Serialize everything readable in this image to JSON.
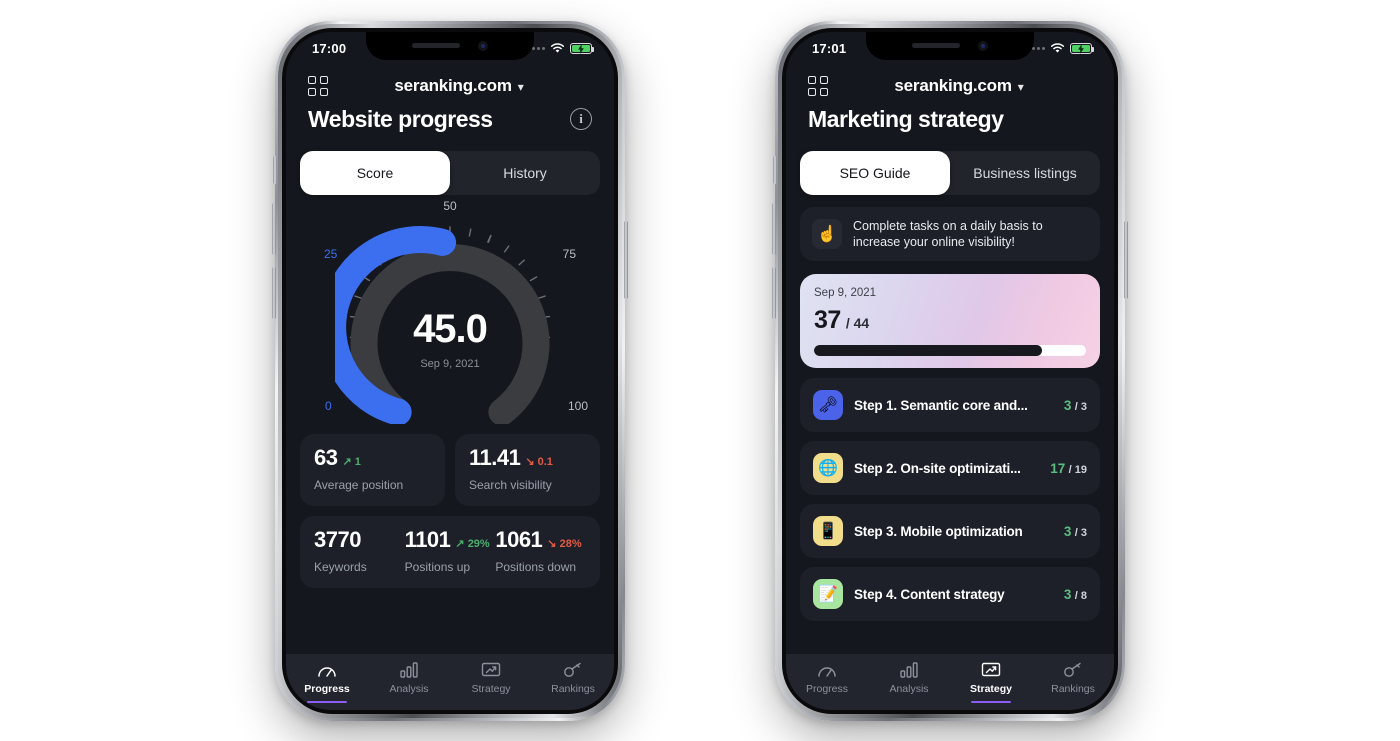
{
  "theme": {
    "bg": "#ffffff",
    "screen_bg": "#15171f",
    "card_bg": "#1d2029",
    "accent_blue": "#3b6ff0",
    "accent_purple": "#8b5cf6",
    "up": "#4caf6d",
    "down": "#e45b44"
  },
  "left": {
    "status": {
      "time": "17:00",
      "signal_icon": "signal-dots-icon",
      "wifi_icon": "wifi-icon",
      "battery_icon": "battery-charging-icon"
    },
    "header": {
      "menu_icon": "grid-menu-icon",
      "domain": "seranking.com",
      "chevron": "⌄",
      "info_icon": "info-icon"
    },
    "page_title": "Website progress",
    "tabs": [
      {
        "label": "Score",
        "active": true
      },
      {
        "label": "History",
        "active": false
      }
    ],
    "gauge": {
      "value": "45.0",
      "date": "Sep 9, 2021",
      "min": 0,
      "max": 100,
      "labels": {
        "zero": "0",
        "quarter": "25",
        "half": "50",
        "three_quarter": "75",
        "full": "100"
      }
    },
    "stats_primary": [
      {
        "value": "63",
        "delta": "1",
        "direction": "up",
        "arrow": "↗",
        "label": "Average position"
      },
      {
        "value": "11.41",
        "delta": "0.1",
        "direction": "down",
        "arrow": "↘",
        "label": "Search visibility"
      }
    ],
    "stats_secondary": [
      {
        "value": "3770",
        "delta": "",
        "direction": "",
        "arrow": "",
        "label": "Keywords"
      },
      {
        "value": "1101",
        "delta": "29%",
        "direction": "up",
        "arrow": "↗",
        "label": "Positions up"
      },
      {
        "value": "1061",
        "delta": "28%",
        "direction": "down",
        "arrow": "↘",
        "label": "Positions down"
      }
    ],
    "nav": [
      {
        "label": "Progress",
        "icon": "gauge-icon",
        "active": true
      },
      {
        "label": "Analysis",
        "icon": "bar-chart-icon",
        "active": false
      },
      {
        "label": "Strategy",
        "icon": "trending-up-screen-icon",
        "active": false
      },
      {
        "label": "Rankings",
        "icon": "key-icon",
        "active": false
      }
    ]
  },
  "right": {
    "status": {
      "time": "17:01",
      "signal_icon": "signal-dots-icon",
      "wifi_icon": "wifi-icon",
      "battery_icon": "battery-charging-icon"
    },
    "header": {
      "menu_icon": "grid-menu-icon",
      "domain": "seranking.com",
      "chevron": "⌄"
    },
    "page_title": "Marketing strategy",
    "tabs": [
      {
        "label": "SEO Guide",
        "active": true
      },
      {
        "label": "Business listings",
        "active": false
      }
    ],
    "banner": {
      "emoji": "☝",
      "emoji_name": "pointing-up-finger-icon",
      "text": "Complete tasks on a daily basis to increase your online visibility!"
    },
    "progress_card": {
      "date": "Sep 9, 2021",
      "completed": "37",
      "total": "/ 44",
      "percent": 84
    },
    "steps": [
      {
        "title": "Step 1. Semantic core and...",
        "done": "3",
        "total": "/ 3",
        "emoji": "🗝",
        "emoji_name": "key-icon",
        "bg": "#4b63e8"
      },
      {
        "title": "Step 2. On-site optimizati...",
        "done": "17",
        "total": "/ 19",
        "emoji": "🌐",
        "emoji_name": "globe-money-icon",
        "bg": "#f2dd8a"
      },
      {
        "title": "Step 3. Mobile optimization",
        "done": "3",
        "total": "/ 3",
        "emoji": "📱",
        "emoji_name": "mobile-phone-icon",
        "bg": "#f2dd8a"
      },
      {
        "title": "Step 4. Content strategy",
        "done": "3",
        "total": "/ 8",
        "emoji": "📝",
        "emoji_name": "paper-plane-icon",
        "bg": "#a8e6a0"
      }
    ],
    "nav": [
      {
        "label": "Progress",
        "icon": "gauge-icon",
        "active": false
      },
      {
        "label": "Analysis",
        "icon": "bar-chart-icon",
        "active": false
      },
      {
        "label": "Strategy",
        "icon": "trending-up-screen-icon",
        "active": true
      },
      {
        "label": "Rankings",
        "icon": "key-icon",
        "active": false
      }
    ]
  }
}
